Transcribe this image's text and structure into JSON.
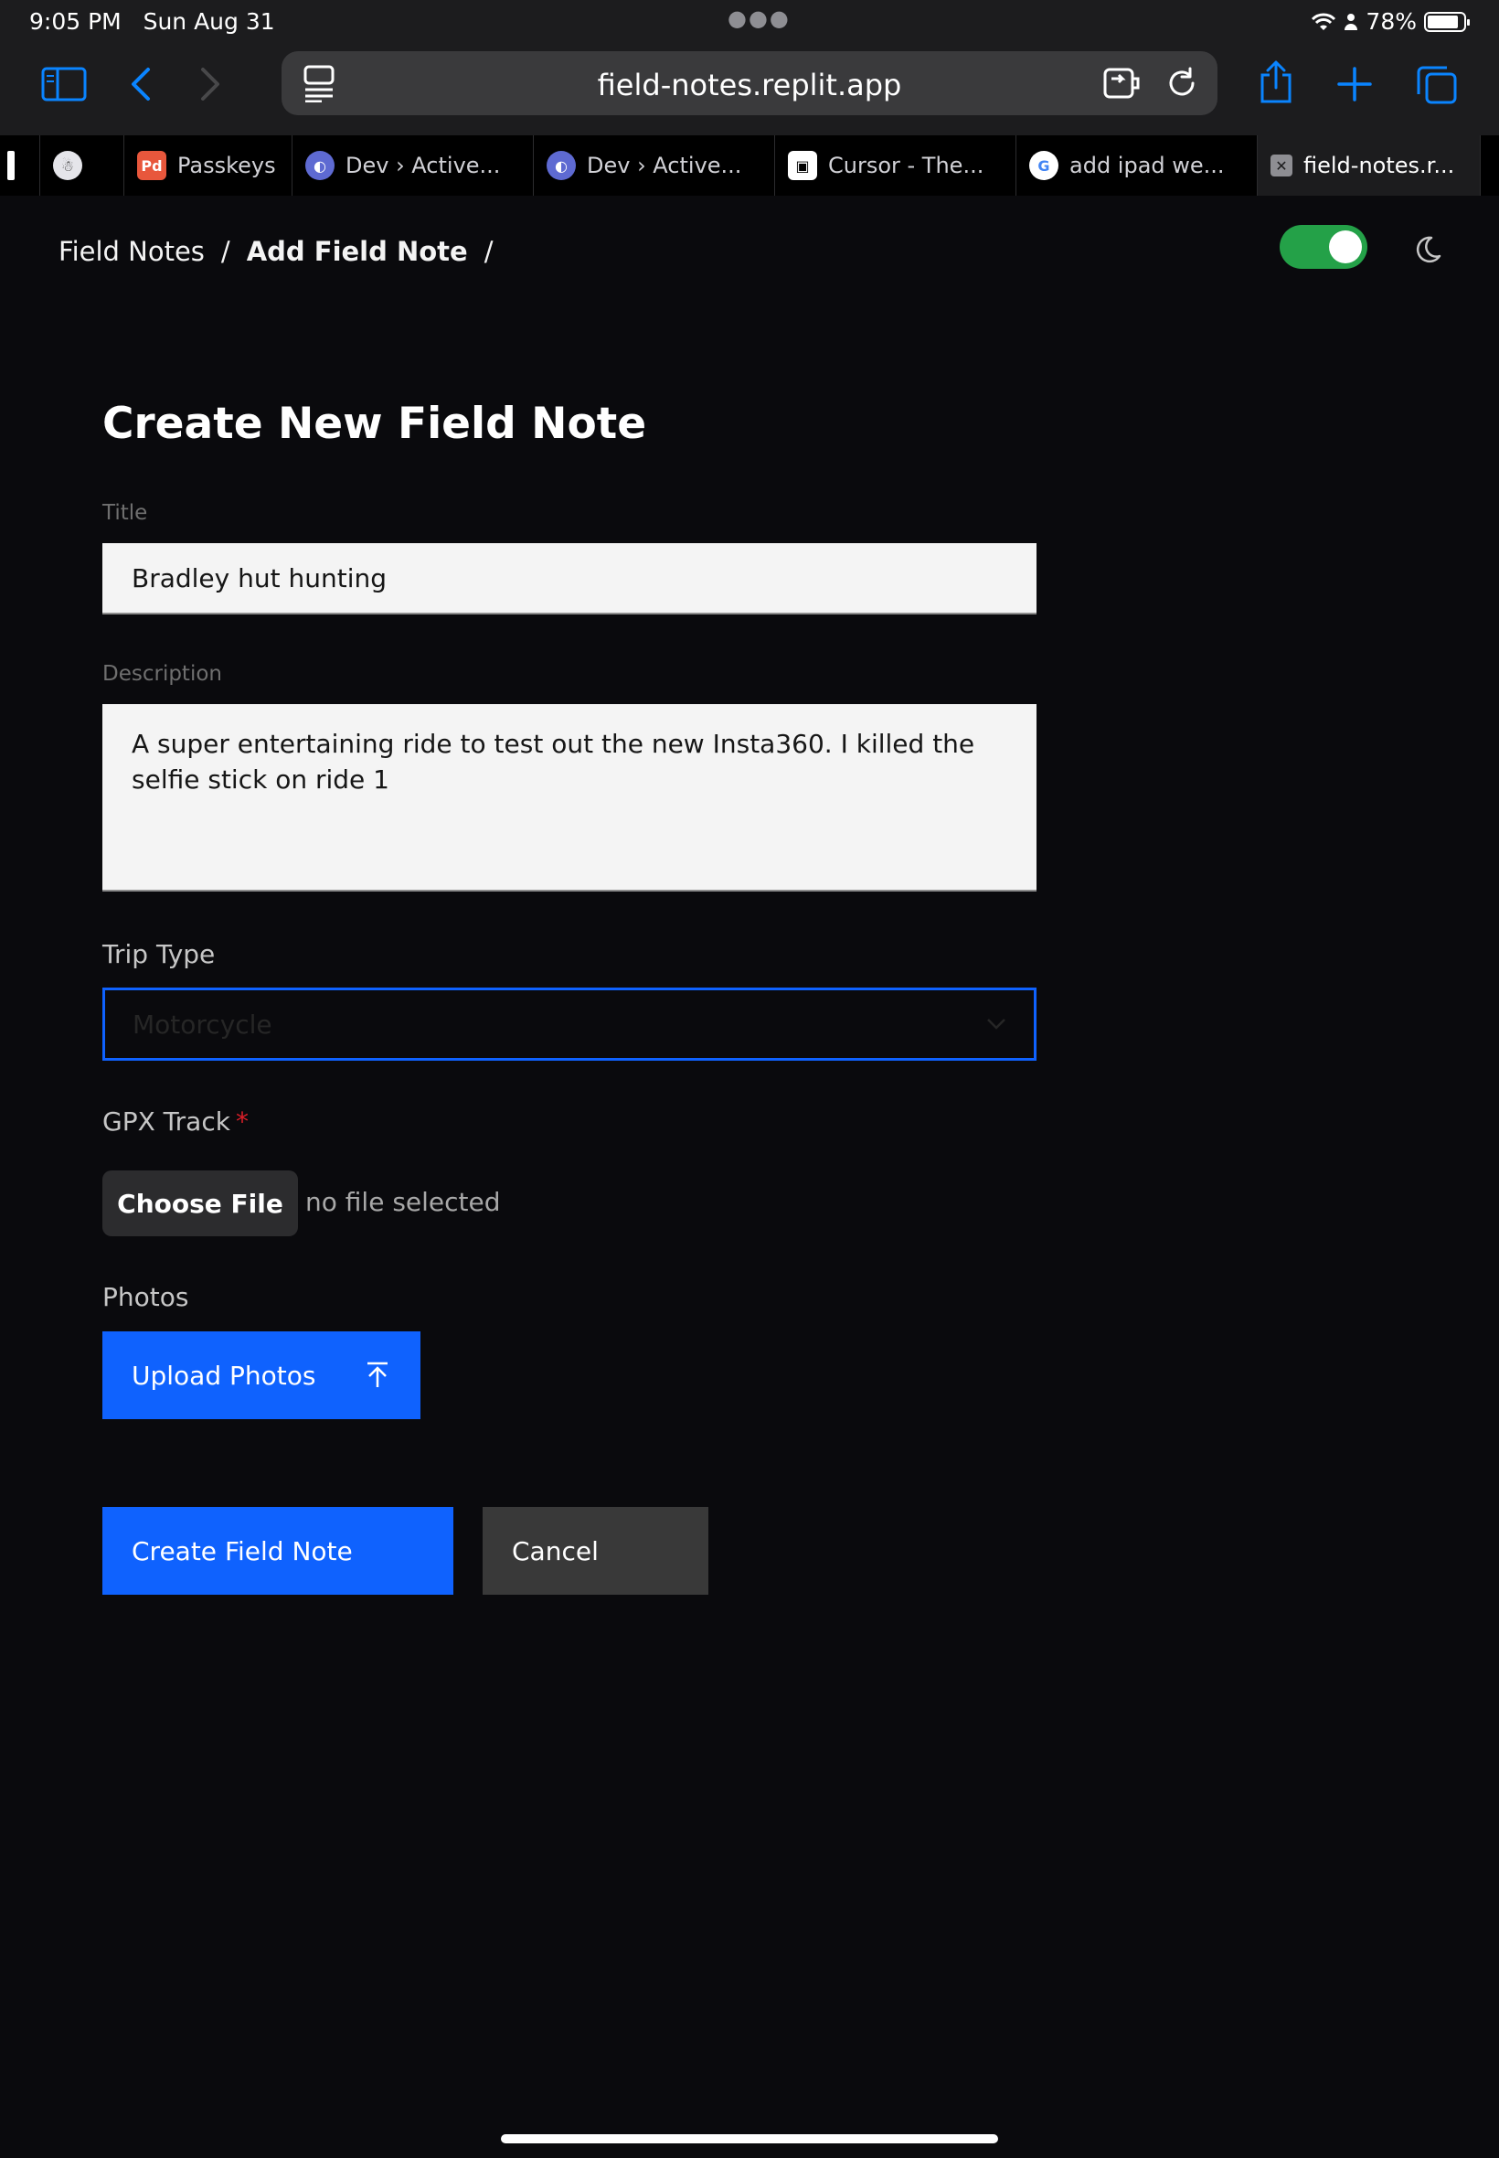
{
  "status_bar": {
    "time": "9:05 PM",
    "date": "Sun Aug 31",
    "battery": "78%",
    "battery_level": 0.78
  },
  "browser": {
    "url": "field-notes.replit.app",
    "tabs": [
      {
        "label": "",
        "icon": "app-icon"
      },
      {
        "label": "",
        "icon": "ghost-icon"
      },
      {
        "label": "Passkeys",
        "icon": "pd-icon"
      },
      {
        "label": "Dev › Active...",
        "icon": "linear-icon"
      },
      {
        "label": "Dev › Active...",
        "icon": "linear-icon"
      },
      {
        "label": "Cursor - The...",
        "icon": "cursor-icon"
      },
      {
        "label": "add ipad we...",
        "icon": "google-icon"
      },
      {
        "label": "field-notes.r...",
        "icon": "close-icon"
      }
    ]
  },
  "header": {
    "breadcrumb_root": "Field Notes",
    "breadcrumb_separator": "/",
    "breadcrumb_current": "Add Field Note",
    "toggle_on": true
  },
  "form": {
    "heading": "Create New Field Note",
    "title_label": "Title",
    "title_value": "Bradley hut hunting",
    "description_label": "Description",
    "description_value": "A super entertaining ride to test out the new Insta360. I killed the selfie stick on ride 1",
    "trip_type_label": "Trip Type",
    "trip_type_value": "Motorcycle",
    "gpx_label": "GPX Track",
    "gpx_required": "*",
    "choose_file_label": "Choose File",
    "no_file_text": "no file selected",
    "photos_label": "Photos",
    "upload_photos_label": "Upload Photos",
    "create_label": "Create Field Note",
    "cancel_label": "Cancel"
  },
  "colors": {
    "primary": "#0f62fe",
    "toggle": "#24a148",
    "background": "#0a0a0d"
  }
}
